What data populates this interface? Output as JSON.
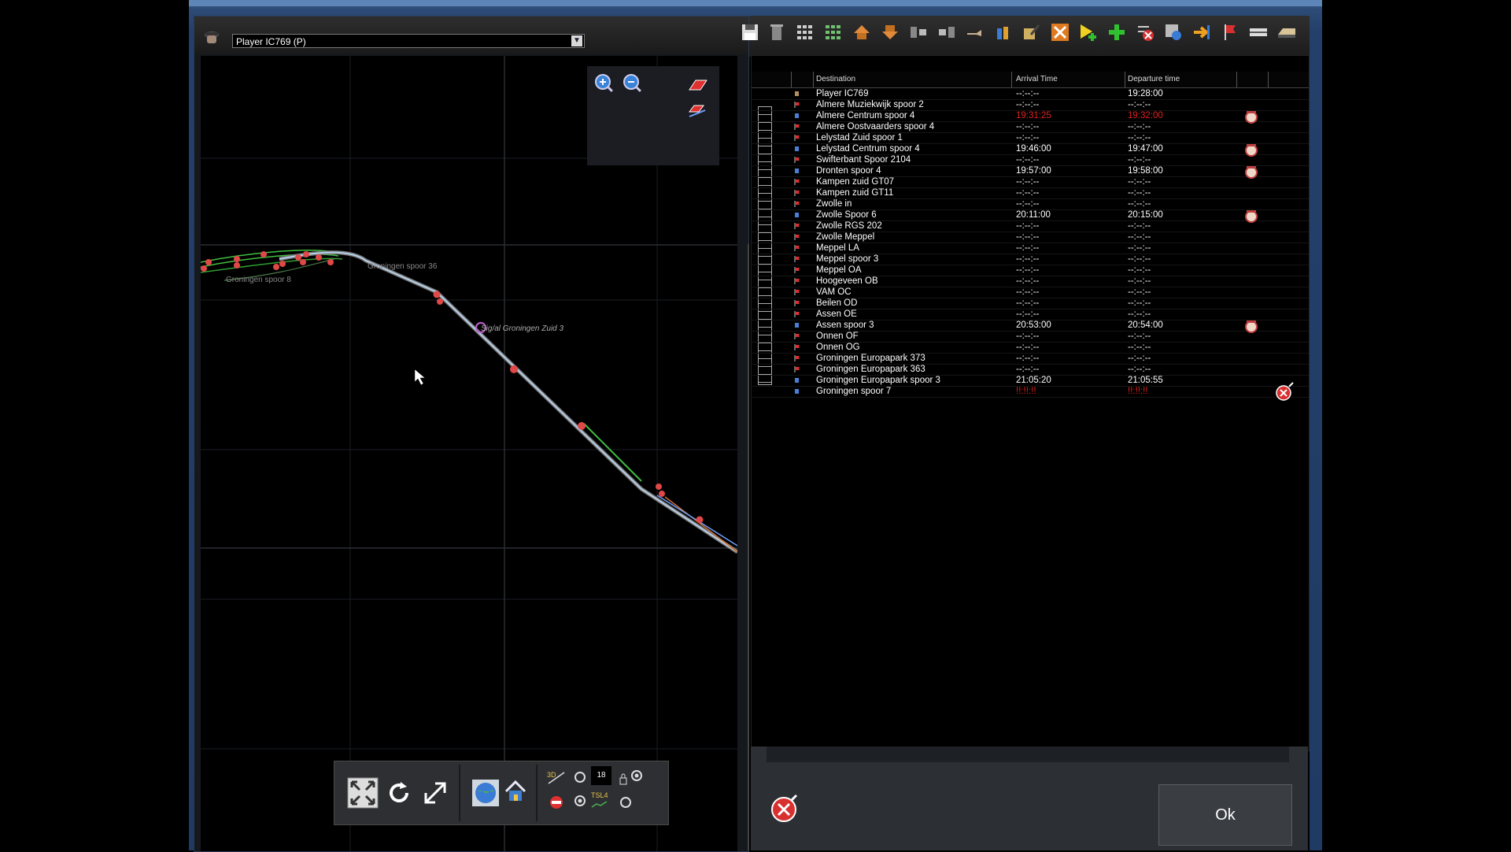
{
  "map": {
    "train_select": "Player IC769 (P)",
    "dropdown_arrow": "▼",
    "labels": {
      "groningen_spoor_8": "Groningen spoor 8",
      "groningen_spoor_36": "Groningen spoor 36",
      "signal_label": "Sig/al Groningen Zuid 3"
    }
  },
  "map_toolbar": {
    "counter": "18",
    "tsl": "TSL4"
  },
  "timetable": {
    "columns": {
      "destination": "Destination",
      "arrival": "Arrival Time",
      "departure": "Departure time"
    },
    "rows": [
      {
        "dest": "Player IC769",
        "arr": "--:--:--",
        "dep": "19:28:00",
        "kind": "train",
        "alarm": false,
        "red": false
      },
      {
        "dest": "Almere Muziekwijk spoor 2",
        "arr": "--:--:--",
        "dep": "--:--:--",
        "kind": "flag",
        "alarm": false,
        "red": false
      },
      {
        "dest": "Almere Centrum spoor 4",
        "arr": "19:31:25",
        "dep": "19:32:00",
        "kind": "stop",
        "alarm": true,
        "red": true
      },
      {
        "dest": "Almere Oostvaarders spoor 4",
        "arr": "--:--:--",
        "dep": "--:--:--",
        "kind": "flag",
        "alarm": false,
        "red": false
      },
      {
        "dest": "Lelystad Zuid spoor 1",
        "arr": "--:--:--",
        "dep": "--:--:--",
        "kind": "flag",
        "alarm": false,
        "red": false
      },
      {
        "dest": "Lelystad Centrum spoor 4",
        "arr": "19:46:00",
        "dep": "19:47:00",
        "kind": "stop",
        "alarm": true,
        "red": false
      },
      {
        "dest": "Swifterbant Spoor 2104",
        "arr": "--:--:--",
        "dep": "--:--:--",
        "kind": "flag",
        "alarm": false,
        "red": false
      },
      {
        "dest": "Dronten spoor 4",
        "arr": "19:57:00",
        "dep": "19:58:00",
        "kind": "stop",
        "alarm": true,
        "red": false
      },
      {
        "dest": "Kampen zuid GT07",
        "arr": "--:--:--",
        "dep": "--:--:--",
        "kind": "flag",
        "alarm": false,
        "red": false
      },
      {
        "dest": "Kampen zuid GT11",
        "arr": "--:--:--",
        "dep": "--:--:--",
        "kind": "flag",
        "alarm": false,
        "red": false
      },
      {
        "dest": "Zwolle in",
        "arr": "--:--:--",
        "dep": "--:--:--",
        "kind": "flag",
        "alarm": false,
        "red": false
      },
      {
        "dest": "Zwolle Spoor 6",
        "arr": "20:11:00",
        "dep": "20:15:00",
        "kind": "stop",
        "alarm": true,
        "red": false
      },
      {
        "dest": "Zwolle RGS 202",
        "arr": "--:--:--",
        "dep": "--:--:--",
        "kind": "flag",
        "alarm": false,
        "red": false
      },
      {
        "dest": "Zwolle Meppel",
        "arr": "--:--:--",
        "dep": "--:--:--",
        "kind": "flag",
        "alarm": false,
        "red": false
      },
      {
        "dest": "Meppel LA",
        "arr": "--:--:--",
        "dep": "--:--:--",
        "kind": "flag",
        "alarm": false,
        "red": false
      },
      {
        "dest": "Meppel spoor 3",
        "arr": "--:--:--",
        "dep": "--:--:--",
        "kind": "flag",
        "alarm": false,
        "red": false
      },
      {
        "dest": "Meppel OA",
        "arr": "--:--:--",
        "dep": "--:--:--",
        "kind": "flag",
        "alarm": false,
        "red": false
      },
      {
        "dest": "Hoogeveen OB",
        "arr": "--:--:--",
        "dep": "--:--:--",
        "kind": "flag",
        "alarm": false,
        "red": false
      },
      {
        "dest": "VAM OC",
        "arr": "--:--:--",
        "dep": "--:--:--",
        "kind": "flag",
        "alarm": false,
        "red": false
      },
      {
        "dest": "Beilen OD",
        "arr": "--:--:--",
        "dep": "--:--:--",
        "kind": "flag",
        "alarm": false,
        "red": false
      },
      {
        "dest": "Assen OE",
        "arr": "--:--:--",
        "dep": "--:--:--",
        "kind": "flag",
        "alarm": false,
        "red": false
      },
      {
        "dest": "Assen spoor 3",
        "arr": "20:53:00",
        "dep": "20:54:00",
        "kind": "stop",
        "alarm": true,
        "red": false
      },
      {
        "dest": "Onnen OF",
        "arr": "--:--:--",
        "dep": "--:--:--",
        "kind": "flag",
        "alarm": false,
        "red": false
      },
      {
        "dest": "Onnen OG",
        "arr": "--:--:--",
        "dep": "--:--:--",
        "kind": "flag",
        "alarm": false,
        "red": false
      },
      {
        "dest": "Groningen Europapark 373",
        "arr": "--:--:--",
        "dep": "--:--:--",
        "kind": "flag",
        "alarm": false,
        "red": false
      },
      {
        "dest": "Groningen Europapark 363",
        "arr": "--:--:--",
        "dep": "--:--:--",
        "kind": "flag",
        "alarm": false,
        "red": false
      },
      {
        "dest": "Groningen Europapark spoor 3",
        "arr": "21:05:20",
        "dep": "21:05:55",
        "kind": "stop",
        "alarm": false,
        "red": false
      },
      {
        "dest": "Groningen spoor 7",
        "arr": "!!:!!:!!",
        "dep": "!!:!!:!!",
        "kind": "stop",
        "alarm": false,
        "red": false,
        "err": true
      }
    ]
  },
  "footer": {
    "ok_label": "Ok"
  },
  "colors": {
    "accent_blue": "#2c4b76",
    "alert_red": "#e02020",
    "track_green": "#3fbf3f"
  }
}
